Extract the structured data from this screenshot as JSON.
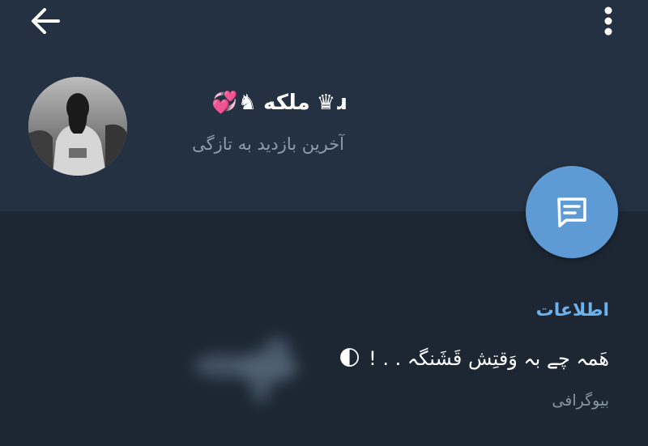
{
  "header": {
    "back_icon": "arrow-left-icon",
    "menu_icon": "more-vertical-icon",
    "avatar_icon": "profile-photo",
    "profile_name": "ملکه",
    "name_decor_left": "💞♞",
    "name_decor_right": "♛ɹ",
    "status": "آخرین بازدید به تازگی"
  },
  "fab": {
    "icon": "message-icon",
    "color": "#5e9ad3"
  },
  "info": {
    "section_title": "اطلاعات",
    "bio_text": "هَمہ چے بہ وَقتِش قَشَنگہ . . !",
    "bio_emoji": "🌓",
    "bio_caption": "بیوگرافی"
  },
  "colors": {
    "background": "#1d2733",
    "header_background": "#243142",
    "accent": "#6cb2ee",
    "secondary_text": "#8f9cab"
  }
}
